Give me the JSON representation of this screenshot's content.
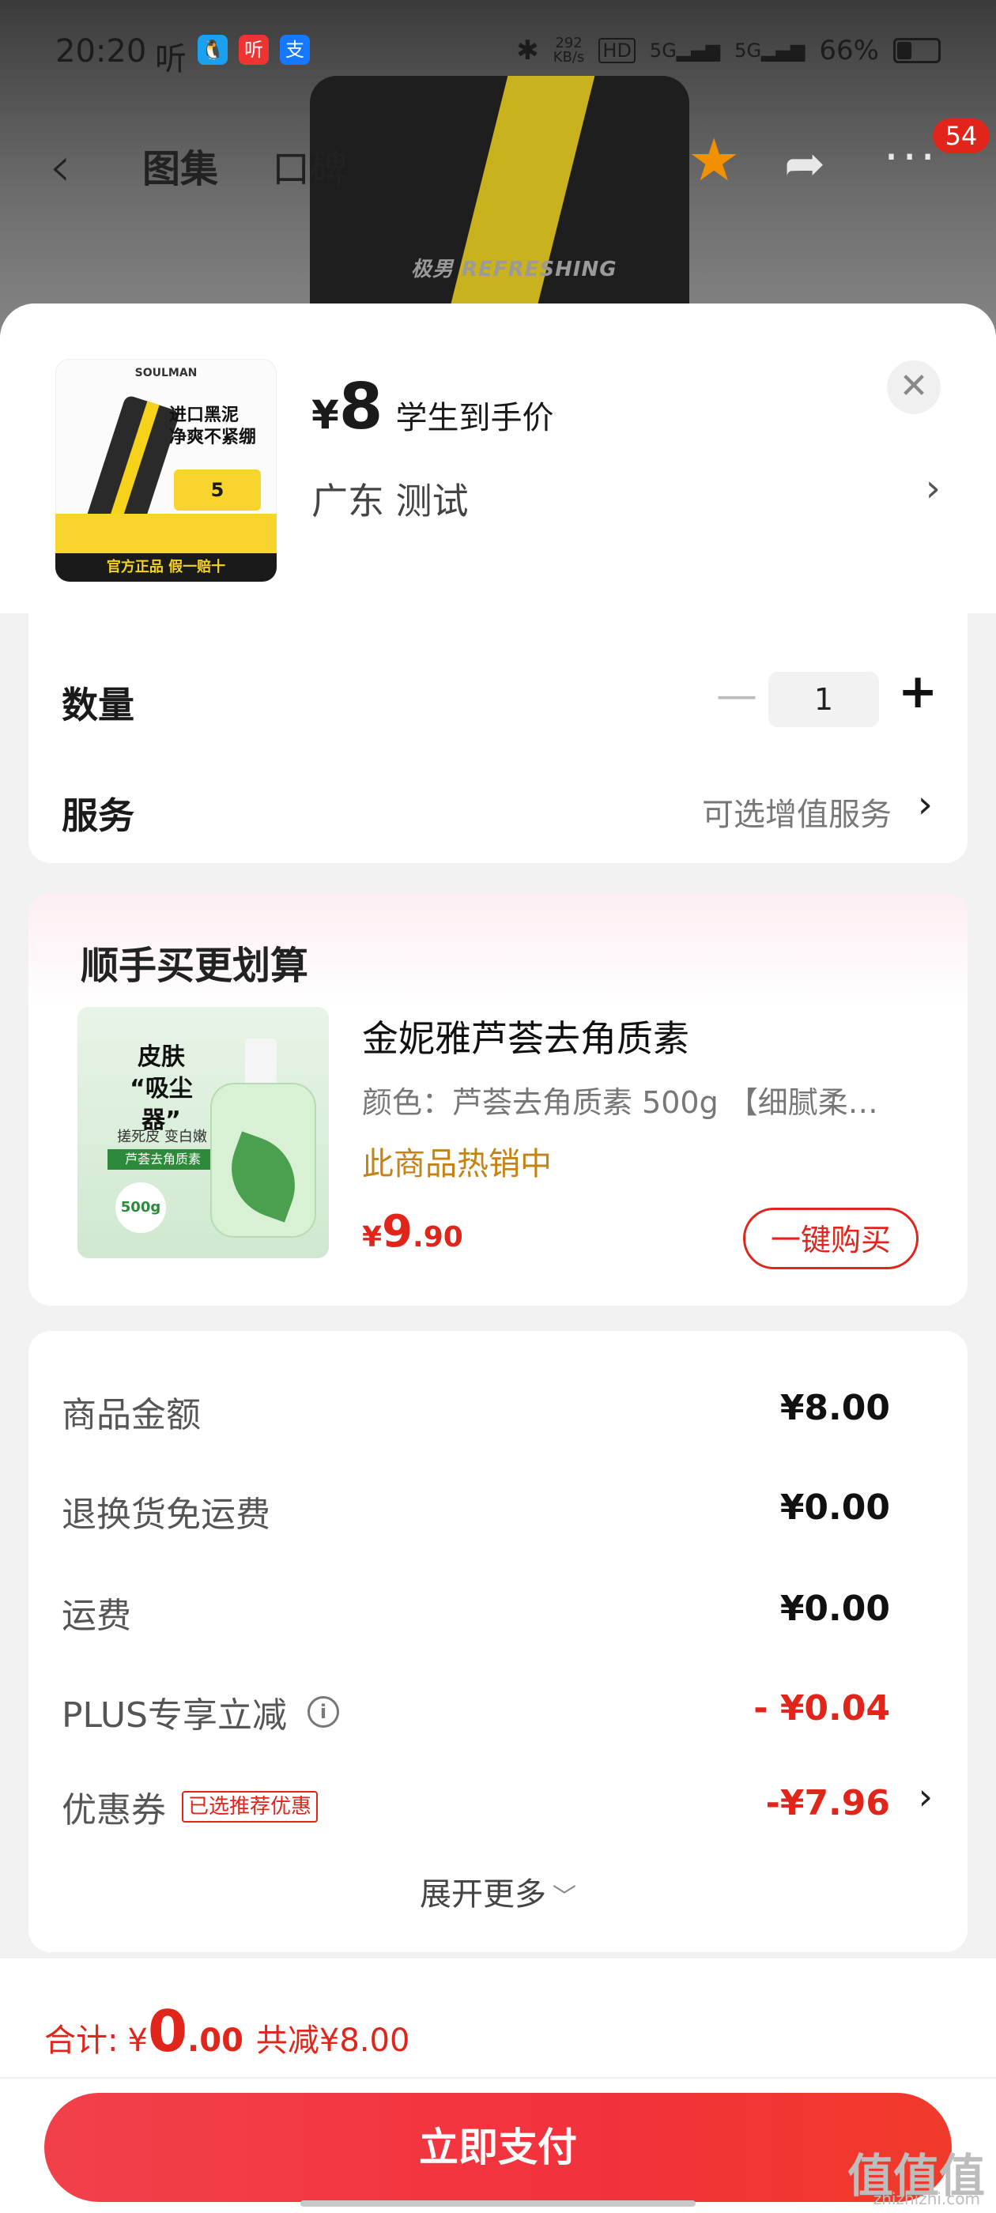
{
  "status_bar": {
    "time": "20:20",
    "network_speed": "292",
    "network_unit": "KB/s",
    "battery": "66%",
    "app_icons": [
      "qq-icon",
      "ting-icon",
      "alipay-icon"
    ]
  },
  "nav": {
    "tabs": [
      {
        "label": "图集",
        "active": true
      },
      {
        "label": "口碑",
        "active": false
      }
    ],
    "badge_count": "54",
    "star_color": "#f29100"
  },
  "background_product": {
    "brand_text": "极男  REFRESHING"
  },
  "product": {
    "thumb": {
      "brand": "SOULMAN",
      "headline_1": "进口黑泥",
      "headline_2": "净爽不紧绷",
      "coupon_value": "5",
      "bottom_banner": "官方正品  假一赔十"
    },
    "price_symbol": "¥",
    "price": "8",
    "price_label": "学生到手价",
    "address": "广东  测试"
  },
  "quantity": {
    "label": "数量",
    "value": "1"
  },
  "service": {
    "label": "服务",
    "hint": "可选增值服务"
  },
  "addon": {
    "title": "顺手买更划算",
    "image_text_1": "皮肤",
    "image_text_2": "“吸尘器”",
    "image_text_3": "搓死皮 变白嫩",
    "image_tag": "芦荟去角质素",
    "image_badge": "500g",
    "name": "金妮雅芦荟去角质素",
    "spec": "颜色：芦荟去角质素 500g 【细腻柔…",
    "hot": "此商品热销中",
    "price_symbol": "¥",
    "price_int": "9",
    "price_dec": ".90",
    "buy_label": "一键购买"
  },
  "summary": {
    "items": [
      {
        "label": "商品金额",
        "value": "¥8.00",
        "red": false
      },
      {
        "label": "退换货免运费",
        "value": "¥0.00",
        "red": false
      },
      {
        "label": "运费",
        "value": "¥0.00",
        "red": false
      },
      {
        "label": "PLUS专享立减",
        "value": "- ¥0.04",
        "red": true
      },
      {
        "label": "优惠券",
        "value": "-¥7.96",
        "red": true
      }
    ],
    "coupon_tag": "已选推荐优惠",
    "expand_label": "展开更多"
  },
  "footer": {
    "total_label": "合计:",
    "total_symbol": "¥",
    "total_int": "0",
    "total_dec": ".00",
    "saved": "共减¥8.00",
    "pay_label": "立即支付"
  },
  "watermark": {
    "main": "值值值",
    "sub": "zhizhizhi.com"
  },
  "colors": {
    "accent_red": "#e1251b",
    "hot_orange": "#c48314"
  }
}
